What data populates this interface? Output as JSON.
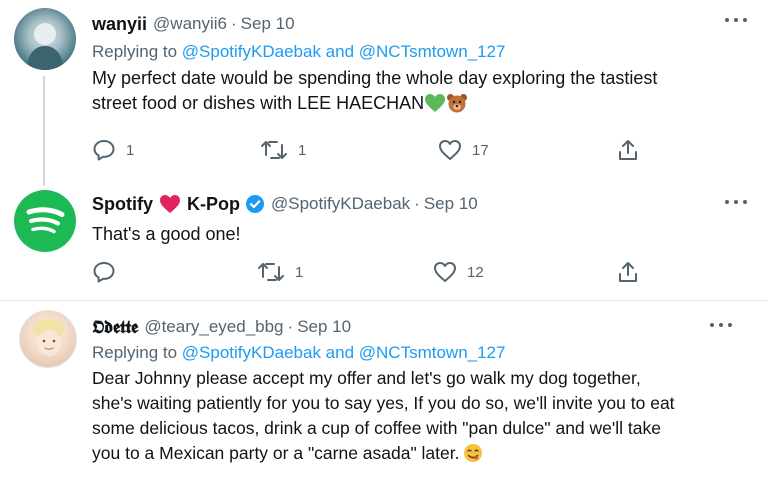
{
  "tweets": [
    {
      "display_name": "wanyii",
      "handle": "@wanyii6",
      "dot": "·",
      "date": "Sep 10",
      "reply_prefix": "Replying to ",
      "reply_mention_1": "@SpotifyKDaebak",
      "reply_and": " and ",
      "reply_mention_2": "@NCTsmtown_127",
      "text_line_1": "My perfect date would be spending the whole day exploring the tastiest",
      "text_line_2": "street food or dishes with LEE HAECHAN",
      "emoji_names": [
        "green-heart-icon",
        "bear-face-icon"
      ],
      "replies": "1",
      "retweets": "1",
      "likes": "17"
    },
    {
      "display_name_1": "Spotify",
      "display_name_2": "K-Pop",
      "handle": "@SpotifyKDaebak",
      "dot": "·",
      "date": "Sep 10",
      "text": "That's a good one!",
      "verified": true,
      "replies": "",
      "retweets": "1",
      "likes": "12"
    },
    {
      "display_name": "𝕺𝖉𝖊𝖙𝖙𝖊",
      "handle": "@teary_eyed_bbg",
      "dot": "·",
      "date": "Sep 10",
      "reply_prefix": "Replying to ",
      "reply_mention_1": "@SpotifyKDaebak",
      "reply_and": " and ",
      "reply_mention_2": "@NCTsmtown_127",
      "text_line_1": "Dear Johnny please accept my offer and let's go walk my dog together,",
      "text_line_2": "she's waiting patiently for you to say yes, If you do so, we'll invite you to eat",
      "text_line_3": "some delicious tacos, drink a cup of coffee with \"pan dulce\" and we'll take",
      "text_line_4": "you to a Mexican party or a \"carne asada\" later.",
      "emoji_names": [
        "savoring-food-icon"
      ]
    }
  ],
  "colors": {
    "link": "#1d9bf0",
    "secondary": "#536471",
    "spotify_green": "#1db954",
    "verified": "#1d9bf0",
    "heart_red": "#e0245e"
  }
}
